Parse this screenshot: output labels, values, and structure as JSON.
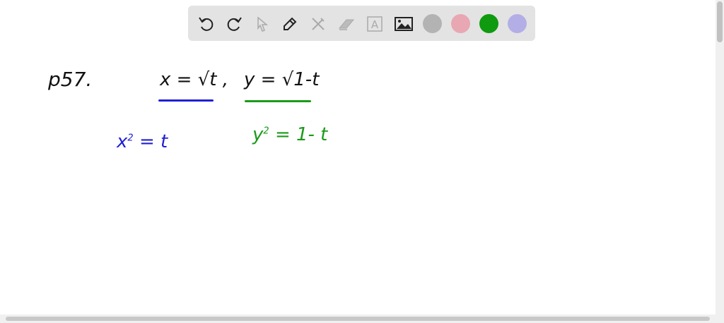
{
  "toolbar": {
    "tools": [
      "undo-icon",
      "redo-icon",
      "select-icon",
      "pen-icon",
      "tools-icon",
      "eraser-icon",
      "text-icon",
      "image-icon"
    ],
    "colors": [
      "#b3b3b3",
      "#e8a7b2",
      "#0f9a0f",
      "#b3aee6"
    ]
  },
  "canvas": {
    "problem_label": "p57.",
    "eq1": "x = √t ,",
    "eq2": "y = √1-t",
    "eq3_base": "x",
    "eq3_exp": "2",
    "eq3_rest": "= t",
    "eq4_base": "y",
    "eq4_exp": "2",
    "eq4_rest": "= 1- t",
    "colors": {
      "black": "#111111",
      "blue": "#1f1fd6",
      "green": "#1a9a1a"
    }
  }
}
